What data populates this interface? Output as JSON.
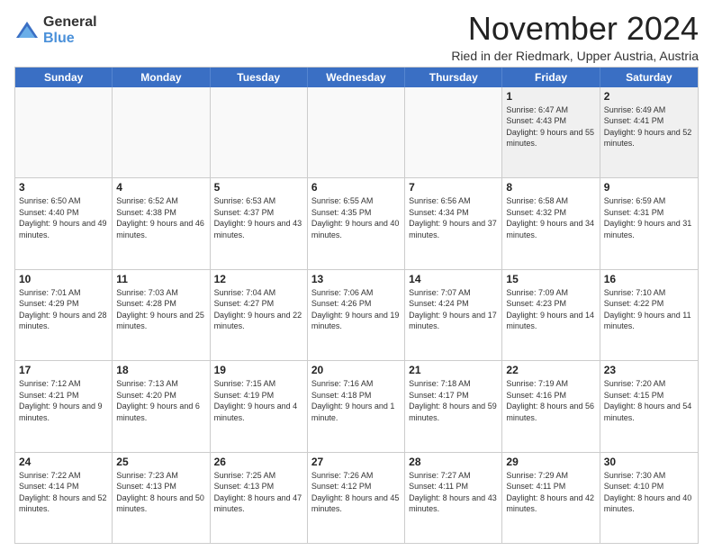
{
  "logo": {
    "general": "General",
    "blue": "Blue"
  },
  "title": "November 2024",
  "subtitle": "Ried in der Riedmark, Upper Austria, Austria",
  "days_of_week": [
    "Sunday",
    "Monday",
    "Tuesday",
    "Wednesday",
    "Thursday",
    "Friday",
    "Saturday"
  ],
  "weeks": [
    [
      {
        "day": "",
        "info": "",
        "empty": true
      },
      {
        "day": "",
        "info": "",
        "empty": true
      },
      {
        "day": "",
        "info": "",
        "empty": true
      },
      {
        "day": "",
        "info": "",
        "empty": true
      },
      {
        "day": "",
        "info": "",
        "empty": true
      },
      {
        "day": "1",
        "info": "Sunrise: 6:47 AM\nSunset: 4:43 PM\nDaylight: 9 hours and 55 minutes."
      },
      {
        "day": "2",
        "info": "Sunrise: 6:49 AM\nSunset: 4:41 PM\nDaylight: 9 hours and 52 minutes."
      }
    ],
    [
      {
        "day": "3",
        "info": "Sunrise: 6:50 AM\nSunset: 4:40 PM\nDaylight: 9 hours and 49 minutes."
      },
      {
        "day": "4",
        "info": "Sunrise: 6:52 AM\nSunset: 4:38 PM\nDaylight: 9 hours and 46 minutes."
      },
      {
        "day": "5",
        "info": "Sunrise: 6:53 AM\nSunset: 4:37 PM\nDaylight: 9 hours and 43 minutes."
      },
      {
        "day": "6",
        "info": "Sunrise: 6:55 AM\nSunset: 4:35 PM\nDaylight: 9 hours and 40 minutes."
      },
      {
        "day": "7",
        "info": "Sunrise: 6:56 AM\nSunset: 4:34 PM\nDaylight: 9 hours and 37 minutes."
      },
      {
        "day": "8",
        "info": "Sunrise: 6:58 AM\nSunset: 4:32 PM\nDaylight: 9 hours and 34 minutes."
      },
      {
        "day": "9",
        "info": "Sunrise: 6:59 AM\nSunset: 4:31 PM\nDaylight: 9 hours and 31 minutes."
      }
    ],
    [
      {
        "day": "10",
        "info": "Sunrise: 7:01 AM\nSunset: 4:29 PM\nDaylight: 9 hours and 28 minutes."
      },
      {
        "day": "11",
        "info": "Sunrise: 7:03 AM\nSunset: 4:28 PM\nDaylight: 9 hours and 25 minutes."
      },
      {
        "day": "12",
        "info": "Sunrise: 7:04 AM\nSunset: 4:27 PM\nDaylight: 9 hours and 22 minutes."
      },
      {
        "day": "13",
        "info": "Sunrise: 7:06 AM\nSunset: 4:26 PM\nDaylight: 9 hours and 19 minutes."
      },
      {
        "day": "14",
        "info": "Sunrise: 7:07 AM\nSunset: 4:24 PM\nDaylight: 9 hours and 17 minutes."
      },
      {
        "day": "15",
        "info": "Sunrise: 7:09 AM\nSunset: 4:23 PM\nDaylight: 9 hours and 14 minutes."
      },
      {
        "day": "16",
        "info": "Sunrise: 7:10 AM\nSunset: 4:22 PM\nDaylight: 9 hours and 11 minutes."
      }
    ],
    [
      {
        "day": "17",
        "info": "Sunrise: 7:12 AM\nSunset: 4:21 PM\nDaylight: 9 hours and 9 minutes."
      },
      {
        "day": "18",
        "info": "Sunrise: 7:13 AM\nSunset: 4:20 PM\nDaylight: 9 hours and 6 minutes."
      },
      {
        "day": "19",
        "info": "Sunrise: 7:15 AM\nSunset: 4:19 PM\nDaylight: 9 hours and 4 minutes."
      },
      {
        "day": "20",
        "info": "Sunrise: 7:16 AM\nSunset: 4:18 PM\nDaylight: 9 hours and 1 minute."
      },
      {
        "day": "21",
        "info": "Sunrise: 7:18 AM\nSunset: 4:17 PM\nDaylight: 8 hours and 59 minutes."
      },
      {
        "day": "22",
        "info": "Sunrise: 7:19 AM\nSunset: 4:16 PM\nDaylight: 8 hours and 56 minutes."
      },
      {
        "day": "23",
        "info": "Sunrise: 7:20 AM\nSunset: 4:15 PM\nDaylight: 8 hours and 54 minutes."
      }
    ],
    [
      {
        "day": "24",
        "info": "Sunrise: 7:22 AM\nSunset: 4:14 PM\nDaylight: 8 hours and 52 minutes."
      },
      {
        "day": "25",
        "info": "Sunrise: 7:23 AM\nSunset: 4:13 PM\nDaylight: 8 hours and 50 minutes."
      },
      {
        "day": "26",
        "info": "Sunrise: 7:25 AM\nSunset: 4:13 PM\nDaylight: 8 hours and 47 minutes."
      },
      {
        "day": "27",
        "info": "Sunrise: 7:26 AM\nSunset: 4:12 PM\nDaylight: 8 hours and 45 minutes."
      },
      {
        "day": "28",
        "info": "Sunrise: 7:27 AM\nSunset: 4:11 PM\nDaylight: 8 hours and 43 minutes."
      },
      {
        "day": "29",
        "info": "Sunrise: 7:29 AM\nSunset: 4:11 PM\nDaylight: 8 hours and 42 minutes."
      },
      {
        "day": "30",
        "info": "Sunrise: 7:30 AM\nSunset: 4:10 PM\nDaylight: 8 hours and 40 minutes."
      }
    ]
  ]
}
